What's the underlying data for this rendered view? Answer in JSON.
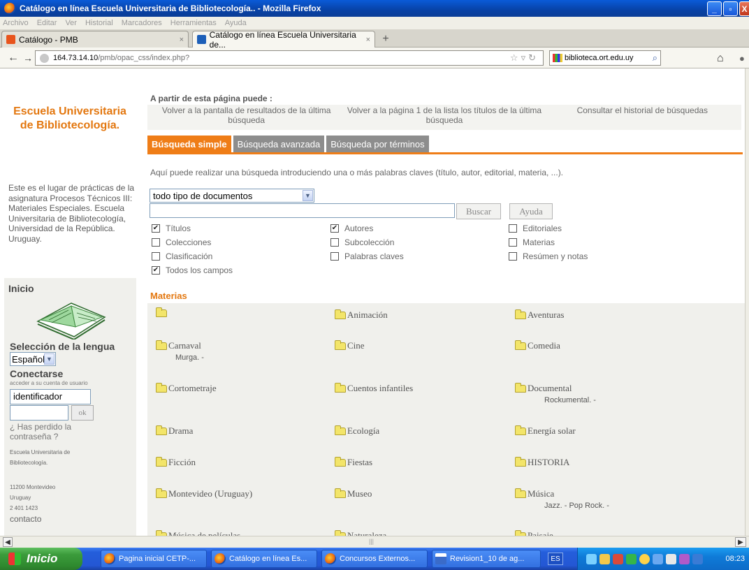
{
  "window": {
    "title": "Catálogo en línea Escuela Universitaria de Bibliotecología.. - Mozilla Firefox",
    "min_label": "_",
    "max_label": "▫",
    "close_label": "X"
  },
  "menu": [
    "Archivo",
    "Editar",
    "Ver",
    "Historial",
    "Marcadores",
    "Herramientas",
    "Ayuda"
  ],
  "browser_tabs": [
    {
      "label": "Catálogo - PMB",
      "close": "×"
    },
    {
      "label": "Catálogo en línea Escuela Universitaria de...",
      "close": "×"
    }
  ],
  "new_tab_label": "+",
  "url": {
    "host": "164.73.14.10",
    "path": "/pmb/opac_css/index.php?"
  },
  "search_box": {
    "value": "biblioteca.ort.edu.uy"
  },
  "sidebar": {
    "brand_line1": "Escuela Universitaria",
    "brand_line2": "de Bibliotecología.",
    "description": "Este es el lugar de prácticas de la asignatura Procesos Técnicos III: Materiales Especiales. Escuela Universitaria de Bibliotecología, Universidad de la República. Uruguay.",
    "home_label": "Inicio",
    "language_label": "Selección de la lengua",
    "language_value": "Español",
    "connect_label": "Conectarse",
    "account_label": "acceder a su cuenta de usuario",
    "login_value": "identificador",
    "ok_label": "ok",
    "forgot_label": "¿ Has perdido la contraseña ?",
    "institution": "Escuela Universitaria de Bibliotecología.",
    "address_line1": "11200 Montevideo",
    "address_line2": "Uruguay",
    "address_line3": "2 401 1423",
    "contact_label": "contacto"
  },
  "history": {
    "title": "A partir de esta página puede :",
    "links": [
      "Volver a la pantalla de resultados de la última búsqueda",
      "Volver a la página 1 de la lista los títulos de la última búsqueda",
      "Consultar el historial de búsquedas"
    ]
  },
  "search_tabs": [
    "Búsqueda simple",
    "Búsqueda avanzada",
    "Búsqueda por términos"
  ],
  "search": {
    "hint": "Aquí puede realizar una búsqueda introduciendo una o más palabras claves (título, autor, editorial, materia, ...).",
    "doc_type": "todo tipo de documentos",
    "search_button": "Buscar",
    "help_button": "Ayuda",
    "options": [
      {
        "label": "Títulos",
        "checked": true
      },
      {
        "label": "Autores",
        "checked": true
      },
      {
        "label": "Editoriales",
        "checked": false
      },
      {
        "label": "Colecciones",
        "checked": false
      },
      {
        "label": "Subcolección",
        "checked": false
      },
      {
        "label": "Materias",
        "checked": false
      },
      {
        "label": "Clasificación",
        "checked": false
      },
      {
        "label": "Palabras claves",
        "checked": false
      },
      {
        "label": "Resúmen y notas",
        "checked": false
      },
      {
        "label": "Todos los campos",
        "checked": true
      }
    ]
  },
  "materias": {
    "title": "Materias",
    "items": [
      {
        "label": "",
        "sub": ""
      },
      {
        "label": "Animación",
        "sub": ""
      },
      {
        "label": "Aventuras",
        "sub": ""
      },
      {
        "label": "Carnaval",
        "sub": "Murga. -"
      },
      {
        "label": "Cine",
        "sub": ""
      },
      {
        "label": "Comedia",
        "sub": ""
      },
      {
        "label": "Cortometraje",
        "sub": ""
      },
      {
        "label": "Cuentos infantiles",
        "sub": ""
      },
      {
        "label": "Documental",
        "sub": "Rockumental. -"
      },
      {
        "label": "Drama",
        "sub": ""
      },
      {
        "label": "Ecología",
        "sub": ""
      },
      {
        "label": "Energía solar",
        "sub": ""
      },
      {
        "label": "Ficción",
        "sub": ""
      },
      {
        "label": "Fiestas",
        "sub": ""
      },
      {
        "label": "HISTORIA",
        "sub": ""
      },
      {
        "label": "Montevideo (Uruguay)",
        "sub": ""
      },
      {
        "label": "Museo",
        "sub": ""
      },
      {
        "label": "Música",
        "sub": "Jazz. - Pop Rock. -"
      },
      {
        "label": "Música de películas",
        "sub": ""
      },
      {
        "label": "Naturaleza",
        "sub": ""
      },
      {
        "label": "Paisaje",
        "sub": ""
      }
    ]
  },
  "taskbar": {
    "start_label": "Inicio",
    "items": [
      "Pagina inicial CETP-...",
      "Catálogo en línea Es...",
      "Concursos Externos...",
      "Revision1_10 de ag..."
    ],
    "language": "ES",
    "clock": "08:23"
  },
  "colors": {
    "accent_orange": "#ef7d17",
    "brand_orange": "#e3770f",
    "tab_gray": "#8d8d8d",
    "xp_blue": "#245edb"
  }
}
